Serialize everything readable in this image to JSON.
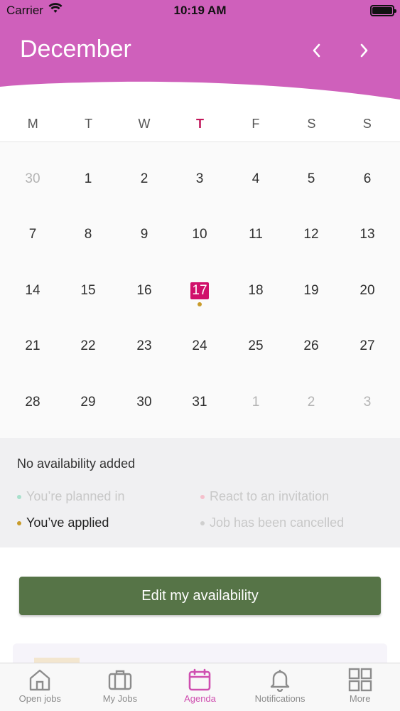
{
  "status_bar": {
    "carrier": "Carrier",
    "time": "10:19 AM"
  },
  "header": {
    "month": "December",
    "prev_icon": "chevron-left-icon",
    "next_icon": "chevron-right-icon"
  },
  "weekdays": [
    "M",
    "T",
    "W",
    "T",
    "F",
    "S",
    "S"
  ],
  "calendar": {
    "weeks": [
      [
        "30",
        "1",
        "2",
        "3",
        "4",
        "5",
        "6"
      ],
      [
        "7",
        "8",
        "9",
        "10",
        "11",
        "12",
        "13"
      ],
      [
        "14",
        "15",
        "16",
        "17",
        "18",
        "19",
        "20"
      ],
      [
        "21",
        "22",
        "23",
        "24",
        "25",
        "26",
        "27"
      ],
      [
        "28",
        "29",
        "30",
        "31",
        "1",
        "2",
        "3"
      ]
    ],
    "selected_day": "17"
  },
  "legend": {
    "no_availability": "No availability added",
    "planned": "You’re planned in",
    "invitation": "React to an invitation",
    "applied": "You’ve applied",
    "cancelled": "Job has been cancelled"
  },
  "button": {
    "edit_label": "Edit my availability"
  },
  "tabs": [
    {
      "label": "Open jobs",
      "icon": "home-icon"
    },
    {
      "label": "My Jobs",
      "icon": "briefcase-icon"
    },
    {
      "label": "Agenda",
      "icon": "calendar-icon"
    },
    {
      "label": "Notifications",
      "icon": "bell-icon"
    },
    {
      "label": "More",
      "icon": "grid-icon"
    }
  ],
  "colors": {
    "header": "#cf60bb",
    "today": "#c2185b",
    "selected": "#d0106a",
    "applied_dot": "#c89b2a",
    "planned_dot": "#a8e0cc",
    "invitation_dot": "#f5c0cc",
    "cancelled_dot": "#cfcfcf",
    "button": "#567447",
    "active_tab": "#cf4fb0"
  }
}
